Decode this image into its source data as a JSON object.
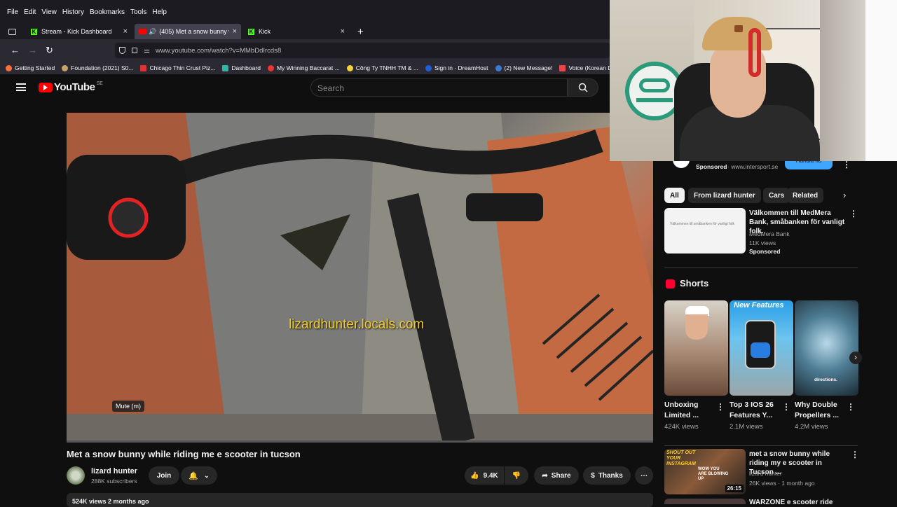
{
  "menu": [
    "File",
    "Edit",
    "View",
    "History",
    "Bookmarks",
    "Tools",
    "Help"
  ],
  "tabs": [
    {
      "label": "Stream - Kick Dashboard"
    },
    {
      "label": "(405) Met a snow bunny wh"
    },
    {
      "label": "Kick"
    }
  ],
  "url": "www.youtube.com/watch?v=MMbDdIrcds8",
  "bookmarks": [
    "Getting Started",
    "Foundation (2021) S0...",
    "Chicago Thin Crust Piz...",
    "Dashboard",
    "My Winning Baccarat ...",
    "Công Ty TNHH TM & ...",
    "Sign in · DreamHost",
    "(2) New Message!",
    "Voice (Korean Drama) ..."
  ],
  "youtube": {
    "logo_text": "YouTube",
    "region": "SE",
    "search_placeholder": "Search"
  },
  "video": {
    "watermark": "lizardhunter.locals.com",
    "tooltip": "Mute (m)",
    "title": "Met a snow bunny while riding me e scooter in tucson",
    "channel": "lizard hunter",
    "subscribers": "288K subscribers",
    "join": "Join",
    "likes": "9.4K",
    "share": "Share",
    "thanks": "Thanks",
    "meta": "524K views  2 months ago"
  },
  "sidebar": {
    "sponsored_top": "Sponsored",
    "sponsored_url": "· www.intersport.se",
    "sponsored_btn": "Handla nu",
    "chips": [
      "All",
      "From lizard hunter",
      "Cars",
      "Related"
    ],
    "ad": {
      "title": "Välkommen till MedMera Bank, småbanken för vanligt folk.",
      "advertiser": "MedMera Bank",
      "views": "11K views",
      "badge": "Sponsored",
      "thumb_text": "Välkommen till småbanken för vanligt folk"
    },
    "shorts_heading": "Shorts",
    "shorts": [
      {
        "title": "Unboxing Limited ...",
        "views": "424K views",
        "overlay": ""
      },
      {
        "title": "Top 3 IOS 26 Features Y...",
        "views": "2.1M views",
        "overlay": "New Features"
      },
      {
        "title": "Why Double Propellers ...",
        "views": "4.2M views",
        "overlay": "directions."
      }
    ],
    "next_video": {
      "title": "met a snow bunny while riding my e scooter in Tucson ...",
      "channel": "lizard hunter",
      "meta": "26K views · 1 month ago",
      "duration": "26:15",
      "thumb_text_1": "SHOUT OUT YOUR INSTAGRAM",
      "thumb_text_2": "WOW YOU ARE BLOWING UP"
    },
    "cut_video_title": "WARZONE e scooter ride"
  },
  "colors": {
    "yt_red": "#ff0000",
    "kick_green": "#53fc18",
    "watermark": "#f2cc2a"
  }
}
